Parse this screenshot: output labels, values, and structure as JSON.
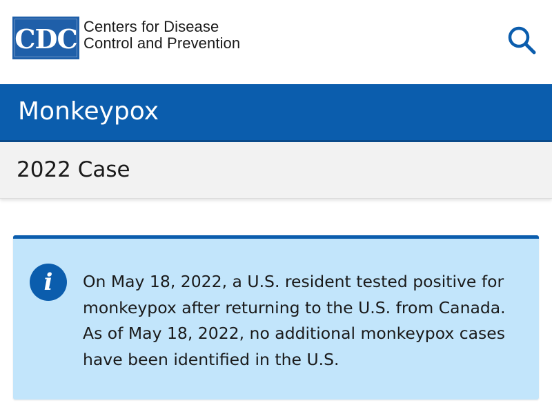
{
  "header": {
    "logo_abbr": "CDC",
    "logo_line1": "Centers for Disease",
    "logo_line2": "Control and Prevention",
    "search_icon": "search-icon"
  },
  "topic": {
    "title": "Monkeypox"
  },
  "subnav": {
    "label": "2022 Case"
  },
  "alert": {
    "icon": "info-icon",
    "icon_glyph": "i",
    "lines": [
      "On May 18, 2022, a U.S. resident tested positive for",
      "monkeypox after returning to the U.S. from Canada.",
      "As of May 18, 2022, no additional monkeypox cases",
      "have been identified in the U.S."
    ]
  },
  "colors": {
    "brand_blue": "#0b5dad",
    "alert_bg": "#c2e5fb",
    "subnav_bg": "#f2f2f2"
  }
}
